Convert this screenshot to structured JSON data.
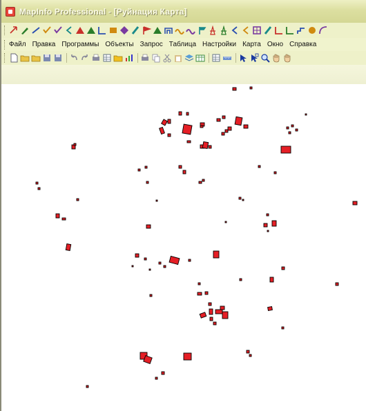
{
  "window": {
    "title": "MapInfo Professional - [Руйнация Карта]"
  },
  "menu": {
    "items": [
      "Файл",
      "Правка",
      "Программы",
      "Объекты",
      "Запрос",
      "Таблица",
      "Настройки",
      "Карта",
      "Окно",
      "Справка"
    ]
  },
  "drawing_toolbar": {
    "icons": [
      "arrow-icon",
      "pen-icon",
      "line-icon",
      "check-icon",
      "check-icon",
      "chevron-icon",
      "triangle-icon",
      "triangle-icon",
      "angle-icon",
      "box-icon",
      "diamond-icon",
      "brush-icon",
      "flag-icon",
      "triangle-icon",
      "gate-icon",
      "wave-icon",
      "wave-icon",
      "sign-icon",
      "tower-icon",
      "tower-icon",
      "chevron-icon",
      "chevron-icon",
      "frame-icon",
      "brush-icon",
      "angle-icon",
      "angle-icon",
      "step-icon",
      "circle-icon",
      "curve-icon"
    ]
  },
  "standard_toolbar": {
    "icons": [
      "new-icon",
      "open-icon",
      "open-icon",
      "save-icon",
      "save-icon",
      "undo-icon",
      "redo-icon",
      "print-icon",
      "grid-icon",
      "folder-icon",
      "chart-icon",
      "print-icon",
      "copy-icon",
      "cut-icon",
      "paste-icon",
      "layers-icon",
      "table-icon",
      "grid-icon",
      "ruler-icon",
      "select-icon",
      "pointer-icon",
      "zoom-icon",
      "hand-icon",
      "hand-icon"
    ]
  },
  "map": {
    "feature_fill": "#e51f26",
    "feature_stroke": "#000000",
    "features": "building polygons"
  },
  "colors": {
    "toolbar_bg": "#eef1c9",
    "titlebar_bg": "#d4d794",
    "accent": "#e51f26"
  }
}
